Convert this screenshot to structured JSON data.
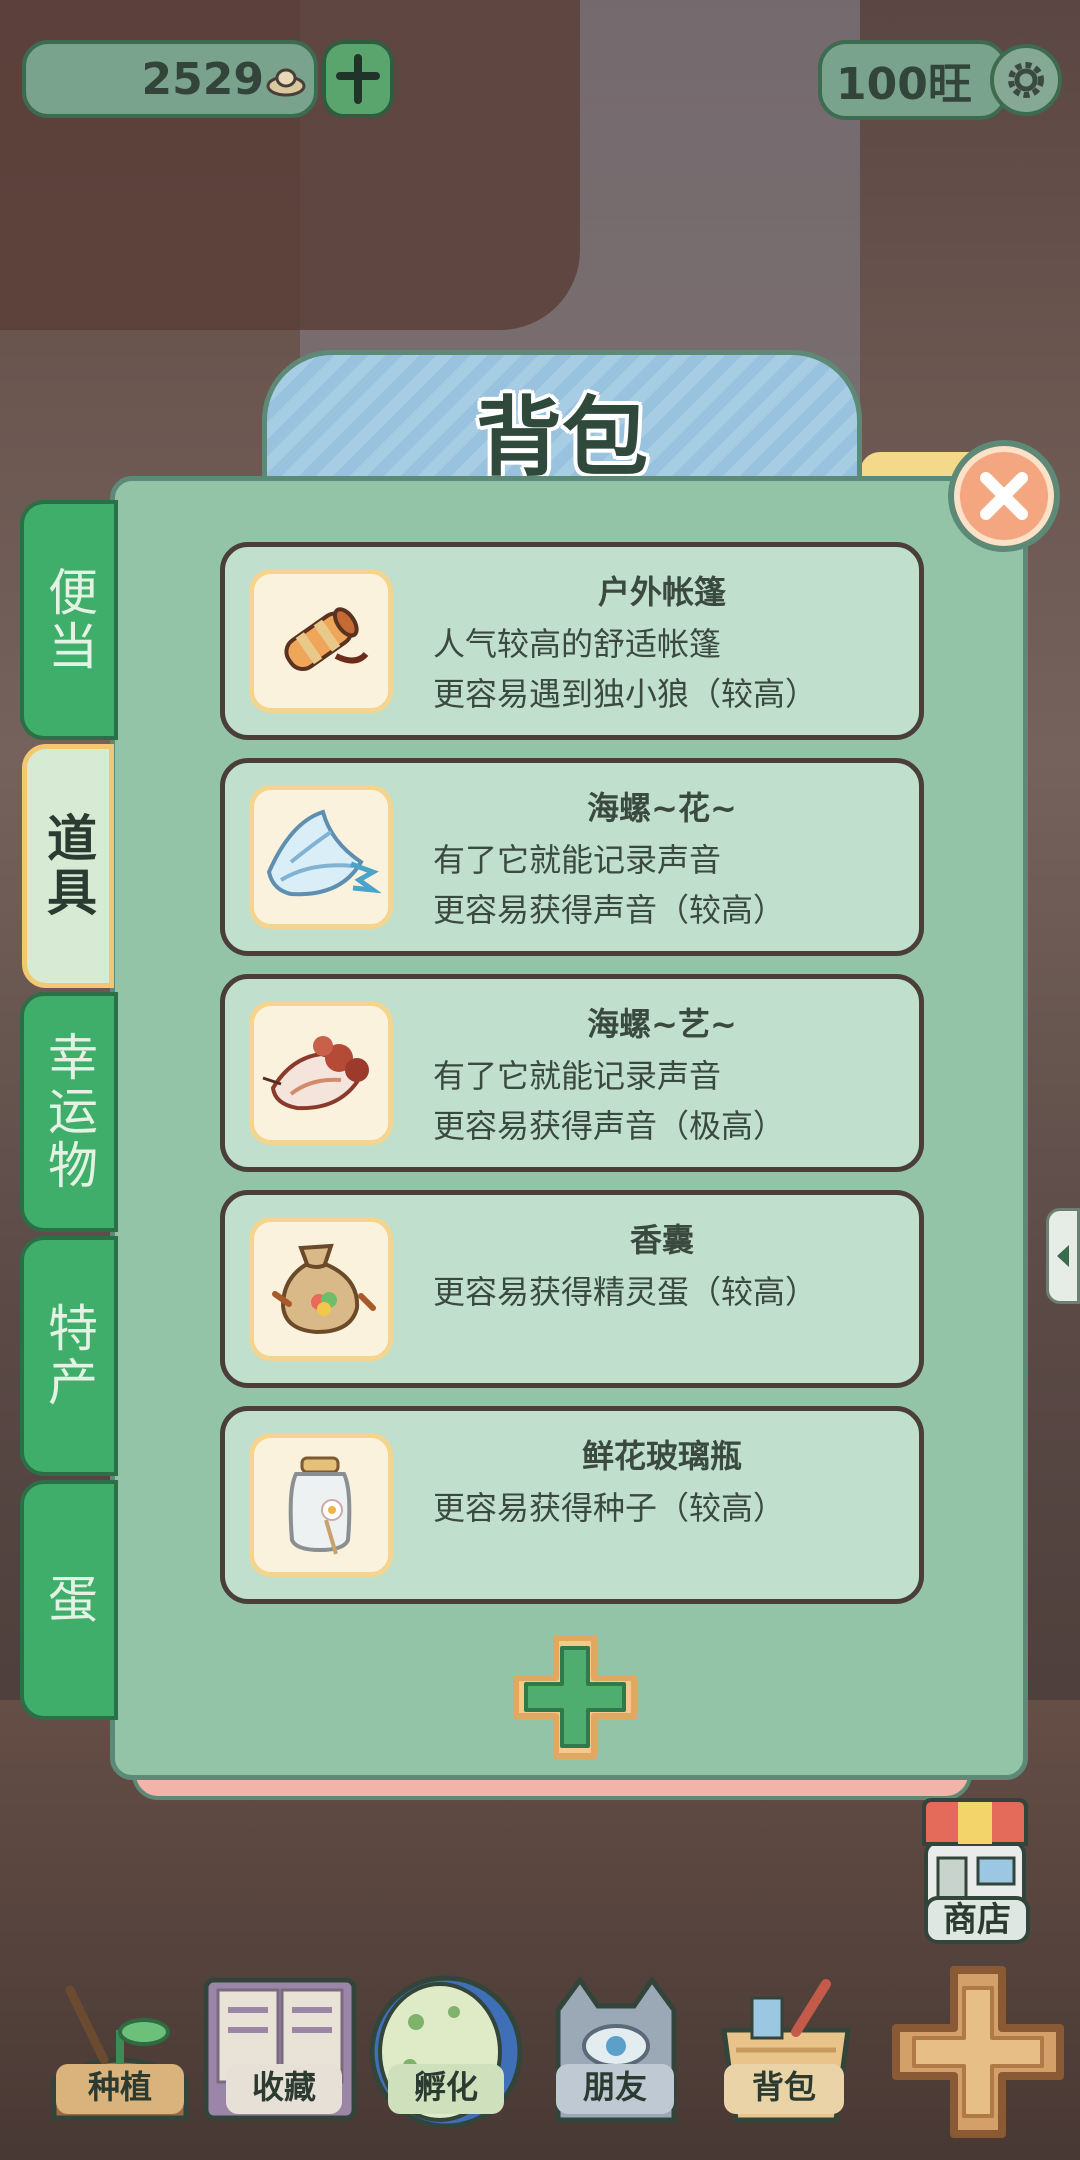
{
  "topbar": {
    "coins": "2529",
    "currency_label": "100旺"
  },
  "panel": {
    "title": "背包"
  },
  "tabs": [
    {
      "label": "便当",
      "active": false
    },
    {
      "label": "道具",
      "active": true
    },
    {
      "label": "幸运物",
      "active": false
    },
    {
      "label": "特产",
      "active": false
    },
    {
      "label": "蛋",
      "active": false
    }
  ],
  "items": [
    {
      "name": "户外帐篷",
      "lines": [
        "人气较高的舒适帐篷",
        "更容易遇到独小狼（较高）"
      ],
      "icon": "tent-roll-icon"
    },
    {
      "name": "海螺~花~",
      "lines": [
        "有了它就能记录声音",
        "更容易获得声音（较高）"
      ],
      "icon": "blue-conch-icon"
    },
    {
      "name": "海螺~艺~",
      "lines": [
        "有了它就能记录声音",
        "更容易获得声音（极高）"
      ],
      "icon": "red-conch-icon"
    },
    {
      "name": "香囊",
      "lines": [
        "更容易获得精灵蛋（较高）"
      ],
      "icon": "sachet-icon"
    },
    {
      "name": "鲜花玻璃瓶",
      "lines": [
        "更容易获得种子（较高）"
      ],
      "icon": "flower-jar-icon"
    }
  ],
  "shop": {
    "label": "商店"
  },
  "nav": [
    {
      "label": "种植",
      "icon": "plant-icon"
    },
    {
      "label": "收藏",
      "icon": "collection-book-icon"
    },
    {
      "label": "孵化",
      "icon": "egg-icon"
    },
    {
      "label": "朋友",
      "icon": "cat-friend-icon"
    },
    {
      "label": "背包",
      "icon": "basket-icon"
    }
  ],
  "colors": {
    "panel": "#93c4a8",
    "tab_green": "#3fae6b",
    "item_bg": "#c0dfcc",
    "close": "#f3a67f"
  }
}
